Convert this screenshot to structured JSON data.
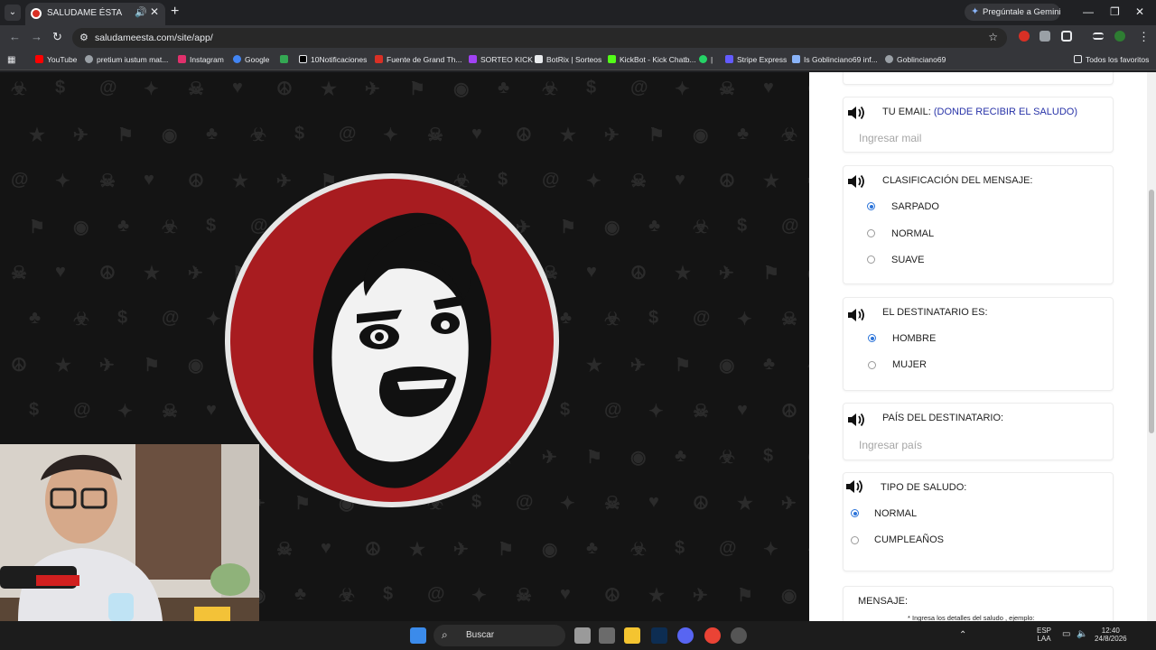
{
  "browser": {
    "tab_title": "SALUDAME ÉSTA",
    "new_tab": "+",
    "gemini_button": "Pregúntale a Gemini",
    "url": "saludameesta.com/site/app/",
    "bookmarks": [
      {
        "label": "YouTube",
        "color": "#ff0000"
      },
      {
        "label": "pretium iustum mat...",
        "color": "#9aa0a6"
      },
      {
        "label": "Instagram",
        "color": "#e1306c"
      },
      {
        "label": "Google",
        "color": "#4285f4"
      },
      {
        "label": "",
        "color": "#34a853"
      },
      {
        "label": "10Notificaciones",
        "color": "#e8eaed"
      },
      {
        "label": "Fuente de Grand Th...",
        "color": "#d93025"
      },
      {
        "label": "SORTEO KICK",
        "color": "#a142f4"
      },
      {
        "label": "BotRix | Sorteos",
        "color": "#e8eaed"
      },
      {
        "label": "KickBot - Kick Chatb...",
        "color": "#53fc18"
      },
      {
        "label": "|",
        "color": "#25d366"
      },
      {
        "label": "Stripe Express",
        "color": "#635bff"
      },
      {
        "label": "Is Goblinciano69 inf...",
        "color": "#8ab4f8"
      },
      {
        "label": "Goblinciano69",
        "color": "#9aa0a6"
      }
    ],
    "all_bookmarks": "Todos los favoritos"
  },
  "form": {
    "email": {
      "label": "TU EMAIL:",
      "hint": "(DONDE RECIBIR EL SALUDO)",
      "placeholder": "Ingresar mail"
    },
    "classification": {
      "label": "CLASIFICACIÓN DEL MENSAJE:",
      "options": [
        "SARPADO",
        "NORMAL",
        "SUAVE"
      ],
      "selected": "SARPADO"
    },
    "recipient": {
      "label": "EL DESTINATARIO ES:",
      "options": [
        "HOMBRE",
        "MUJER"
      ],
      "selected": "HOMBRE"
    },
    "country": {
      "label": "PAÍS DEL DESTINATARIO:",
      "placeholder": "Ingresar país"
    },
    "greeting_type": {
      "label": "TIPO DE SALUDO:",
      "options": [
        "NORMAL",
        "CUMPLEAÑOS"
      ],
      "selected": "NORMAL"
    },
    "message": {
      "label": "MENSAJE:",
      "note": "* Ingresa los detalles del saludo , ejemplo:"
    }
  },
  "taskbar": {
    "search_label": "Buscar",
    "language": "ESP",
    "language_sub": "LAA",
    "time": "12:40",
    "date": "24/8/2026"
  }
}
